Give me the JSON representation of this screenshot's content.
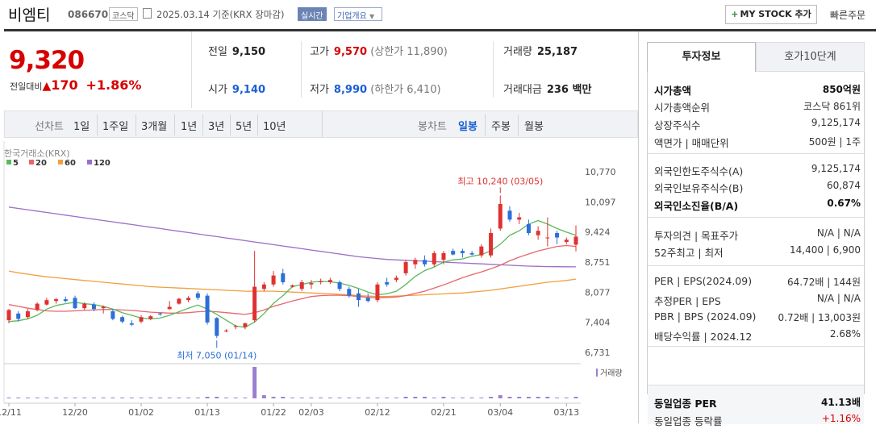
{
  "header": {
    "name": "비엠티",
    "code": "086670",
    "market": "코스닥",
    "date_text": "2025.03.14  기준(KRX 장마감)",
    "realtime_label": "실시간",
    "company_label": "기업개요",
    "mystock_label": "MY STOCK 추가",
    "quick_order_label": "빠른주문"
  },
  "price": {
    "current": "9,320",
    "change_label": "전일대비",
    "change_abs": "170",
    "change_pct": "+1.86%"
  },
  "stats": {
    "prev_label": "전일",
    "prev": "9,150",
    "high_label": "고가",
    "high": "9,570",
    "upper_limit": "(상한가 11,890)",
    "volume_label": "거래량",
    "volume": "25,187",
    "open_label": "시가",
    "open": "9,140",
    "low_label": "저가",
    "low": "8,990",
    "lower_limit": "(하한가 6,410)",
    "amount_label": "거래대금",
    "amount": "236 백만"
  },
  "periods": {
    "line_label": "선차트",
    "line_items": [
      "1일",
      "1주일",
      "3개월",
      "1년",
      "3년",
      "5년",
      "10년"
    ],
    "candle_label": "봉차트",
    "candle_items": [
      "일봉",
      "주봉",
      "월봉"
    ],
    "candle_active": "일봉"
  },
  "colors": {
    "up": "#e03131",
    "down": "#2c6fd8",
    "ma5": "#5cb85c",
    "ma20": "#e8666b",
    "ma60": "#f0a040",
    "ma120": "#9b6fc7",
    "volume": "#9b7fd0"
  },
  "chart_data": {
    "type": "candlestick",
    "source_label": "한국거래소(KRX)",
    "legend": [
      {
        "name": "5",
        "color": "#5cb85c"
      },
      {
        "name": "20",
        "color": "#e8666b"
      },
      {
        "name": "60",
        "color": "#f0a040"
      },
      {
        "name": "120",
        "color": "#9b6fc7"
      }
    ],
    "y_ticks": [
      10770,
      10097,
      9424,
      8751,
      8077,
      7404,
      6731
    ],
    "y_tick_labels": [
      "10,770",
      "10,097",
      "9,424",
      "8,751",
      "8,077",
      "7,404",
      "6,731"
    ],
    "ylim": [
      6731,
      10770
    ],
    "x_tick_labels": [
      {
        "label": "12/11",
        "index": 0
      },
      {
        "label": "12/20",
        "index": 7
      },
      {
        "label": "01/02",
        "index": 14
      },
      {
        "label": "01/13",
        "index": 21
      },
      {
        "label": "01/22",
        "index": 28
      },
      {
        "label": "02/03",
        "index": 32
      },
      {
        "label": "02/12",
        "index": 39
      },
      {
        "label": "02/21",
        "index": 46
      },
      {
        "label": "03/04",
        "index": 52
      },
      {
        "label": "03/13",
        "index": 59
      }
    ],
    "max_annotation": "최고 10,240 (03/05)",
    "min_annotation": "최저 7,050 (01/14)",
    "volume_label": "거래량",
    "candles": [
      {
        "o": 7450,
        "h": 7700,
        "l": 7380,
        "c": 7680
      },
      {
        "o": 7600,
        "h": 7650,
        "l": 7420,
        "c": 7480
      },
      {
        "o": 7520,
        "h": 7700,
        "l": 7480,
        "c": 7650
      },
      {
        "o": 7680,
        "h": 7850,
        "l": 7650,
        "c": 7820
      },
      {
        "o": 7800,
        "h": 7950,
        "l": 7780,
        "c": 7900
      },
      {
        "o": 7880,
        "h": 7950,
        "l": 7820,
        "c": 7920
      },
      {
        "o": 7920,
        "h": 7980,
        "l": 7850,
        "c": 7880
      },
      {
        "o": 7950,
        "h": 8000,
        "l": 7700,
        "c": 7720
      },
      {
        "o": 7720,
        "h": 7850,
        "l": 7680,
        "c": 7820
      },
      {
        "o": 7800,
        "h": 7850,
        "l": 7650,
        "c": 7700
      },
      {
        "o": 7720,
        "h": 7780,
        "l": 7600,
        "c": 7750
      },
      {
        "o": 7650,
        "h": 7700,
        "l": 7450,
        "c": 7480
      },
      {
        "o": 7520,
        "h": 7550,
        "l": 7380,
        "c": 7420
      },
      {
        "o": 7380,
        "h": 7450,
        "l": 7320,
        "c": 7350
      },
      {
        "o": 7420,
        "h": 7560,
        "l": 7380,
        "c": 7520
      },
      {
        "o": 7480,
        "h": 7560,
        "l": 7450,
        "c": 7540
      },
      {
        "o": 7600,
        "h": 7620,
        "l": 7550,
        "c": 7580
      },
      {
        "o": 7700,
        "h": 7880,
        "l": 7680,
        "c": 7750
      },
      {
        "o": 7820,
        "h": 7950,
        "l": 7800,
        "c": 7930
      },
      {
        "o": 7900,
        "h": 7990,
        "l": 7850,
        "c": 7950
      },
      {
        "o": 8050,
        "h": 8100,
        "l": 7900,
        "c": 7950
      },
      {
        "o": 8000,
        "h": 8050,
        "l": 7350,
        "c": 7400
      },
      {
        "o": 7500,
        "h": 7520,
        "l": 7050,
        "c": 7100
      },
      {
        "o": 7200,
        "h": 7250,
        "l": 7180,
        "c": 7220
      },
      {
        "o": 7300,
        "h": 7350,
        "l": 7250,
        "c": 7320
      },
      {
        "o": 7300,
        "h": 7400,
        "l": 7250,
        "c": 7380
      },
      {
        "o": 7450,
        "h": 9000,
        "l": 7400,
        "c": 8200
      },
      {
        "o": 8150,
        "h": 8300,
        "l": 8100,
        "c": 8250
      },
      {
        "o": 8250,
        "h": 8550,
        "l": 8200,
        "c": 8450
      },
      {
        "o": 8500,
        "h": 8600,
        "l": 8250,
        "c": 8300
      },
      {
        "o": 8200,
        "h": 8250,
        "l": 8180,
        "c": 8230
      },
      {
        "o": 8150,
        "h": 8350,
        "l": 8100,
        "c": 8300
      },
      {
        "o": 8250,
        "h": 8350,
        "l": 8150,
        "c": 8280
      },
      {
        "o": 8300,
        "h": 8380,
        "l": 8250,
        "c": 8320
      },
      {
        "o": 8300,
        "h": 8400,
        "l": 8260,
        "c": 8350
      },
      {
        "o": 8300,
        "h": 8340,
        "l": 8100,
        "c": 8150
      },
      {
        "o": 8150,
        "h": 8200,
        "l": 7950,
        "c": 8000
      },
      {
        "o": 8050,
        "h": 8150,
        "l": 7750,
        "c": 7900
      },
      {
        "o": 7950,
        "h": 8050,
        "l": 7850,
        "c": 7880
      },
      {
        "o": 7900,
        "h": 8300,
        "l": 7850,
        "c": 8250
      },
      {
        "o": 8300,
        "h": 8400,
        "l": 8200,
        "c": 8250
      },
      {
        "o": 8350,
        "h": 8450,
        "l": 8300,
        "c": 8400
      },
      {
        "o": 8500,
        "h": 8800,
        "l": 8450,
        "c": 8750
      },
      {
        "o": 8700,
        "h": 8850,
        "l": 8600,
        "c": 8800
      },
      {
        "o": 8800,
        "h": 8900,
        "l": 8650,
        "c": 8700
      },
      {
        "o": 8700,
        "h": 9000,
        "l": 8650,
        "c": 8950
      },
      {
        "o": 8800,
        "h": 9000,
        "l": 8700,
        "c": 8950
      },
      {
        "o": 9000,
        "h": 9050,
        "l": 8900,
        "c": 8920
      },
      {
        "o": 9000,
        "h": 9050,
        "l": 8850,
        "c": 8950
      },
      {
        "o": 8950,
        "h": 9000,
        "l": 8900,
        "c": 8920
      },
      {
        "o": 8900,
        "h": 9150,
        "l": 8850,
        "c": 9100
      },
      {
        "o": 8900,
        "h": 9500,
        "l": 8850,
        "c": 9400
      },
      {
        "o": 9500,
        "h": 10240,
        "l": 9450,
        "c": 10050
      },
      {
        "o": 9900,
        "h": 10000,
        "l": 9650,
        "c": 9700
      },
      {
        "o": 9700,
        "h": 9850,
        "l": 9600,
        "c": 9750
      },
      {
        "o": 9600,
        "h": 9700,
        "l": 9350,
        "c": 9400
      },
      {
        "o": 9350,
        "h": 9550,
        "l": 9250,
        "c": 9450
      },
      {
        "o": 9300,
        "h": 9750,
        "l": 9100,
        "c": 9300
      },
      {
        "o": 9400,
        "h": 9450,
        "l": 9150,
        "c": 9300
      },
      {
        "o": 9200,
        "h": 9300,
        "l": 9150,
        "c": 9250
      },
      {
        "o": 9140,
        "h": 9570,
        "l": 8990,
        "c": 9320
      }
    ],
    "volumes": [
      1,
      1,
      1,
      1,
      1,
      1,
      1,
      1,
      1,
      1,
      1,
      1,
      1,
      1,
      1,
      1,
      1,
      1,
      1,
      1,
      1,
      2,
      2,
      1,
      1,
      1,
      40,
      4,
      2,
      2,
      1,
      1,
      1,
      1,
      1,
      1,
      1,
      1,
      1,
      1,
      1,
      1,
      2,
      2,
      2,
      1,
      2,
      1,
      1,
      1,
      1,
      2,
      4,
      2,
      2,
      2,
      2,
      2,
      1,
      1,
      2
    ],
    "ma5": [
      7420,
      7440,
      7480,
      7560,
      7700,
      7780,
      7820,
      7850,
      7820,
      7800,
      7760,
      7700,
      7620,
      7560,
      7500,
      7480,
      7500,
      7560,
      7640,
      7720,
      7790,
      7700,
      7580,
      7450,
      7320,
      7290,
      7410,
      7600,
      7830,
      8000,
      8200,
      8250,
      8300,
      8320,
      8310,
      8280,
      8230,
      8160,
      8080,
      8020,
      8040,
      8100,
      8250,
      8430,
      8560,
      8640,
      8750,
      8800,
      8820,
      8880,
      8920,
      9000,
      9150,
      9350,
      9450,
      9600,
      9680,
      9600,
      9500,
      9420,
      9350
    ],
    "ma20": [
      7800,
      7760,
      7720,
      7690,
      7660,
      7650,
      7650,
      7660,
      7670,
      7680,
      7690,
      7690,
      7680,
      7670,
      7650,
      7630,
      7620,
      7610,
      7610,
      7620,
      7640,
      7650,
      7640,
      7620,
      7600,
      7580,
      7620,
      7680,
      7760,
      7820,
      7880,
      7930,
      7980,
      8000,
      8010,
      8010,
      8000,
      7980,
      7960,
      7950,
      7960,
      7970,
      8000,
      8050,
      8100,
      8170,
      8240,
      8320,
      8400,
      8470,
      8530,
      8600,
      8680,
      8780,
      8860,
      8930,
      9000,
      9050,
      9100,
      9120,
      9100
    ],
    "ma60": [
      8550,
      8510,
      8480,
      8450,
      8420,
      8400,
      8380,
      8360,
      8340,
      8320,
      8300,
      8280,
      8260,
      8240,
      8220,
      8200,
      8190,
      8180,
      8170,
      8160,
      8150,
      8140,
      8130,
      8120,
      8110,
      8100,
      8100,
      8100,
      8100,
      8090,
      8080,
      8070,
      8060,
      8050,
      8040,
      8030,
      8020,
      8000,
      7990,
      7980,
      7980,
      7990,
      8000,
      8010,
      8020,
      8030,
      8040,
      8050,
      8060,
      8080,
      8100,
      8120,
      8150,
      8180,
      8210,
      8240,
      8270,
      8300,
      8320,
      8340,
      8370
    ],
    "ma120": [
      9980,
      9950,
      9920,
      9890,
      9860,
      9830,
      9800,
      9770,
      9740,
      9710,
      9680,
      9650,
      9620,
      9590,
      9560,
      9530,
      9500,
      9470,
      9440,
      9410,
      9380,
      9350,
      9320,
      9290,
      9260,
      9230,
      9200,
      9170,
      9140,
      9110,
      9080,
      9050,
      9020,
      8990,
      8960,
      8930,
      8900,
      8870,
      8850,
      8830,
      8810,
      8800,
      8790,
      8780,
      8770,
      8760,
      8750,
      8740,
      8730,
      8720,
      8710,
      8700,
      8690,
      8680,
      8670,
      8660,
      8655,
      8650,
      8648,
      8646,
      8645
    ]
  },
  "side": {
    "tab_info": "투자정보",
    "tab_orderbook": "호가10단계",
    "rows": [
      {
        "k": "시가총액",
        "v": "850억원",
        "bold": true
      },
      {
        "k": "시가총액순위",
        "v": "코스닥 861위"
      },
      {
        "k": "상장주식수",
        "v": "9,125,174"
      },
      {
        "k": "액면가 | 매매단위",
        "v": "500원 | 1주"
      },
      {
        "k": "외국인한도주식수(A)",
        "v": "9,125,174"
      },
      {
        "k": "외국인보유주식수(B)",
        "v": "60,874"
      },
      {
        "k": "외국인소진율(B/A)",
        "v": "0.67%",
        "bold": true
      },
      {
        "k": "투자의견 | 목표주가",
        "v": "N/A | N/A"
      },
      {
        "k": "52주최고 | 최저",
        "v": "14,400 | 6,900"
      },
      {
        "k": "PER | EPS(2024.09)",
        "v": "64.72배 | 144원"
      },
      {
        "k": "추정PER | EPS",
        "v": "N/A | N/A"
      },
      {
        "k": "PBR | BPS (2024.09)",
        "v": "0.72배 | 13,003원"
      },
      {
        "k": "배당수익률 | 2024.12",
        "v": "2.68%"
      },
      {
        "k": "동일업종 PER",
        "v": "41.13배",
        "bold": true
      },
      {
        "k": "동일업종 등락률",
        "v": "+1.16%"
      }
    ]
  }
}
